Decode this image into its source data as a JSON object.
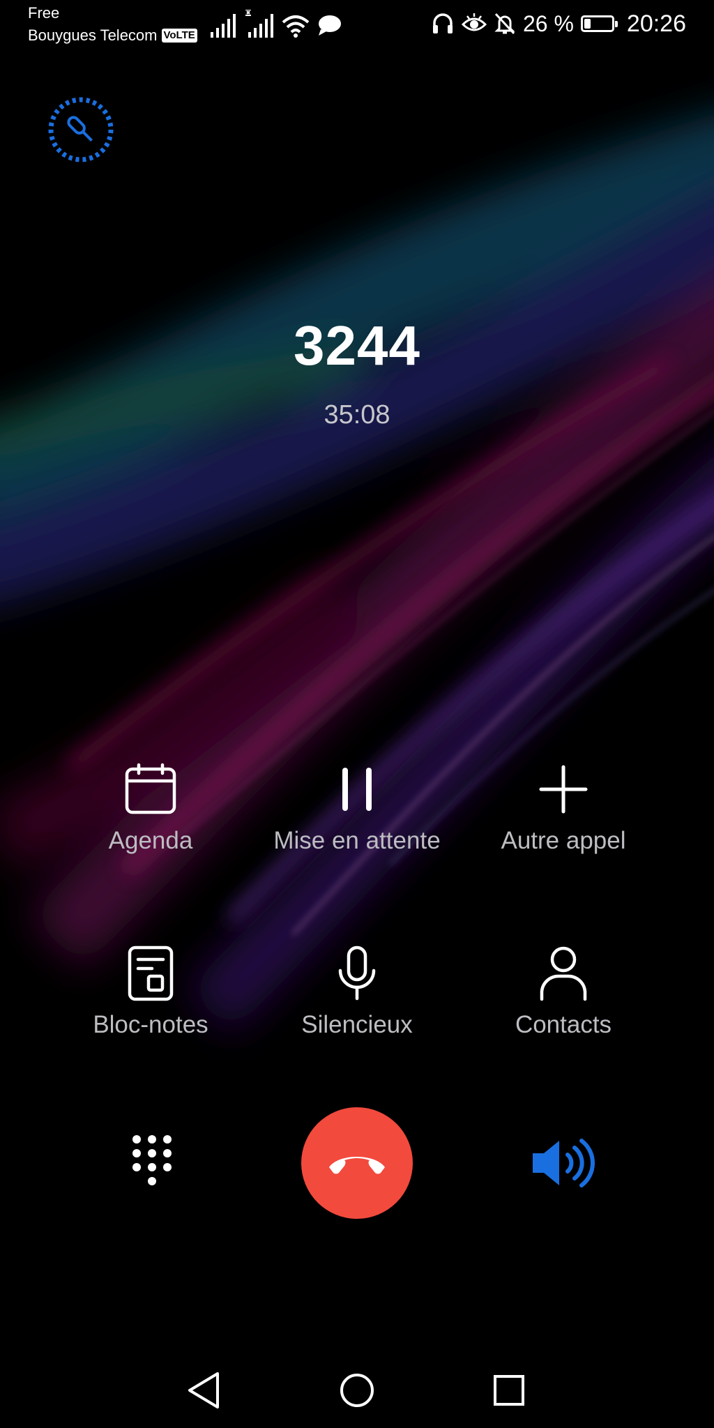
{
  "status_bar": {
    "carrier_primary": "Free",
    "carrier_secondary": "Bouygues Telecom",
    "volte_badge": "VoLTE",
    "battery_text": "26 %",
    "battery_level_percent": 26,
    "time": "20:26",
    "icons": [
      "signal-bars-icon",
      "signal-bars-icon",
      "wifi-icon",
      "message-icon",
      "headset-icon",
      "eye-icon",
      "bell-muted-icon",
      "battery-icon"
    ]
  },
  "call": {
    "number": "3244",
    "duration": "35:08",
    "record_icon": "call-recording-icon"
  },
  "actions": [
    {
      "label": "Agenda",
      "icon": "calendar-icon"
    },
    {
      "label": "Mise en attente",
      "icon": "pause-icon"
    },
    {
      "label": "Autre appel",
      "icon": "plus-icon"
    },
    {
      "label": "Bloc-notes",
      "icon": "notepad-icon"
    },
    {
      "label": "Silencieux",
      "icon": "microphone-icon"
    },
    {
      "label": "Contacts",
      "icon": "contact-person-icon"
    }
  ],
  "controls": {
    "dialpad_icon": "dialpad-icon",
    "end_call_icon": "hang-up-icon",
    "speaker_icon": "speaker-icon",
    "end_call_color": "#f24a3d",
    "speaker_active_color": "#1a6fe0"
  },
  "navigation": {
    "icons": [
      "back-triangle-icon",
      "home-circle-icon",
      "recents-square-icon"
    ]
  }
}
